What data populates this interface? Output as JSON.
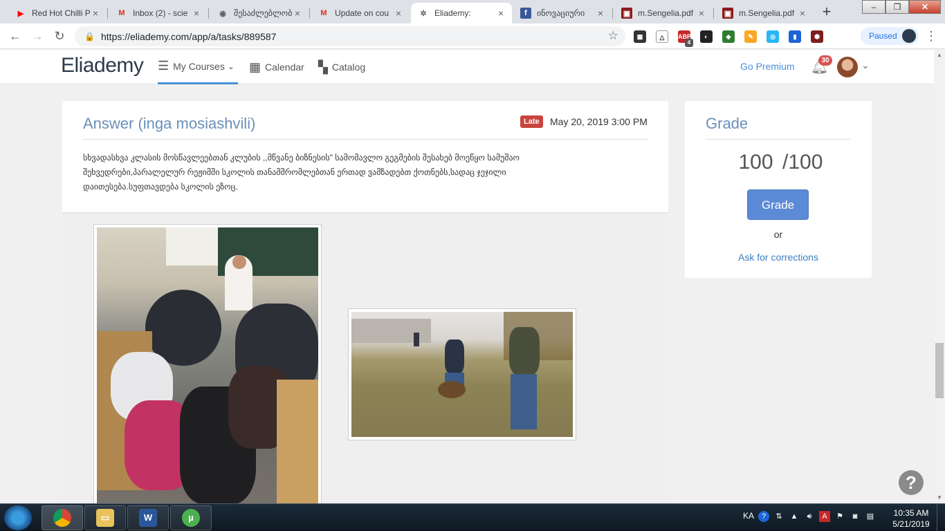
{
  "browser": {
    "tabs": [
      {
        "title": "Red Hot Chilli P",
        "icon": "youtube-icon",
        "color": "#ff0000"
      },
      {
        "title": "Inbox (2) - scie",
        "icon": "gmail-icon",
        "color": "#d93025"
      },
      {
        "title": "შესაძლებლობები",
        "icon": "globe-icon",
        "color": "#5f6368"
      },
      {
        "title": "Update on cou",
        "icon": "gmail-icon",
        "color": "#d93025"
      },
      {
        "title": "Eliademy:",
        "icon": "eliademy-icon",
        "color": "#5f6368"
      },
      {
        "title": "ინოვაციური",
        "icon": "facebook-icon",
        "color": "#3b5998"
      },
      {
        "title": "m.Sengelia.pdf",
        "icon": "pdf-icon",
        "color": "#8b1a1a"
      },
      {
        "title": "m.Sengelia.pdf",
        "icon": "pdf-icon",
        "color": "#8b1a1a"
      }
    ],
    "url": "https://eliademy.com/app/a/tasks/889587",
    "paused_label": "Paused",
    "extension_badge": "4"
  },
  "site": {
    "logo": "Eliademy",
    "nav": {
      "my_courses": "My Courses",
      "calendar": "Calendar",
      "catalog": "Catalog"
    },
    "go_premium": "Go Premium",
    "notification_count": "30"
  },
  "answer": {
    "title": "Answer (inga mosiashvili)",
    "late_badge": "Late",
    "date": "May 20, 2019 3:00 PM",
    "text": "სხვადასხვა კლასის მოსწავლეებთან კლუბის ,,მწვანე ბიზნესის\" სამომავლო გეგმების შესახებ მოეწყო სამუშაო შეხვედრები,პარალელურ რეჟიმში სკოლის თანამშრომლებთან ერთად ვამზადებთ ქოთნებს,სადაც ჯეჯილი დაითესება.სუფთავდება სკოლის ეზოც."
  },
  "grade": {
    "title": "Grade",
    "value": "100",
    "max": "/100",
    "button": "Grade",
    "or": "or",
    "ask_corrections": "Ask for corrections"
  },
  "help_label": "?",
  "taskbar": {
    "language": "KA",
    "time": "10:35 AM",
    "date": "5/21/2019"
  }
}
